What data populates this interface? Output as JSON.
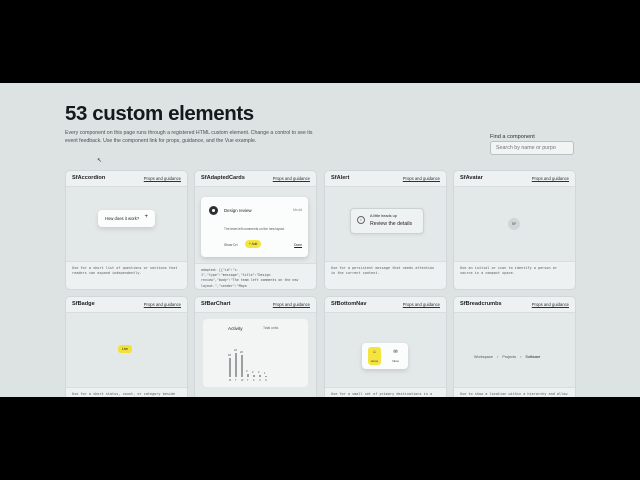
{
  "page": {
    "title": "53 custom elements",
    "intro": "Every component on this page runs through a registered HTML custom element. Change a control to see its event feedback. Use the component link for props, guidance, and the Vue example.",
    "find_label": "Find a component",
    "search_placeholder": "Search by name or purpo"
  },
  "link_label": "Props and guidance",
  "cards": {
    "accordion": {
      "name": "SfAccordion",
      "question": "How does it work?",
      "plus": "+",
      "desc": "Use for a short list of questions or sections that readers can expand independently."
    },
    "adapted": {
      "name": "SfAdaptedCards",
      "title": "Design review",
      "date": "Mn dd",
      "body": "The team left comments on the new layout.",
      "show_label": "Show Crt",
      "chip": "+ Add",
      "done": "Done",
      "code": "adapted: [{\"id\":\"c-\n1\",\"type\":\"message\",\"title\":\"Design\nreview\",\"body\":\"The team left comments on the new\nlayout.\",\"sender\":\"Maya"
    },
    "alert": {
      "name": "SfAlert",
      "icon": "i",
      "heading": "A little heads up",
      "message": "Review the details",
      "desc": "Use for a persistent message that needs attention in the current context."
    },
    "avatar": {
      "name": "SfAvatar",
      "initials": "SF",
      "desc": "Use an initial or icon to identify a person or source in a compact space."
    },
    "badge": {
      "name": "SfBadge",
      "label": "Live",
      "desc": "Use for a short status, count, or category beside other content."
    },
    "barchart": {
      "name": "SfBarChart",
      "title": "Activity",
      "unit": "Total units"
    },
    "bottomnav": {
      "name": "SfBottomNav",
      "items": [
        {
          "label": "Home",
          "icon": "⌂"
        },
        {
          "label": "Inbox",
          "icon": "✉"
        }
      ],
      "desc": "Use for a small set of primary destinations in a narrow layout."
    },
    "breadcrumbs": {
      "name": "SfBreadcrumbs",
      "items": [
        "Workspace",
        "Projects",
        "Software"
      ],
      "separator": "›",
      "desc": "Use to show a location within a hierarchy and allow movement to ancestors."
    }
  },
  "chart_data": {
    "type": "bar",
    "title": "Activity",
    "categories": [
      "M",
      "T",
      "W",
      "T",
      "F",
      "S",
      "S"
    ],
    "values": [
      18,
      22,
      20,
      3,
      2,
      2,
      1
    ],
    "ylim": [
      0,
      24
    ]
  }
}
